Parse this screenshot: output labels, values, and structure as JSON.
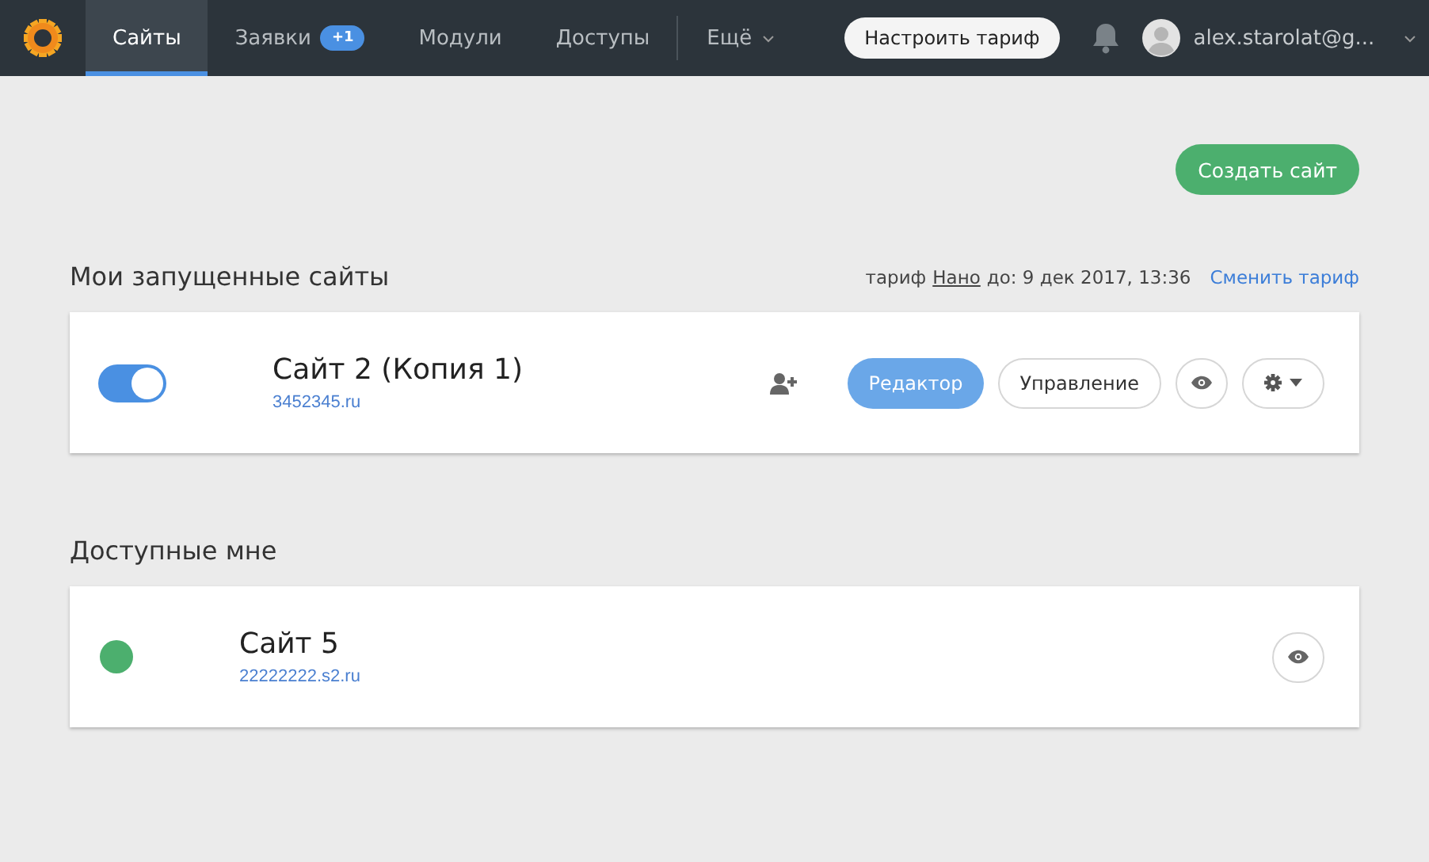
{
  "nav": {
    "tabs": [
      {
        "label": "Сайты",
        "selected": true
      },
      {
        "label": "Заявки",
        "selected": false,
        "badge": "+1"
      },
      {
        "label": "Модули",
        "selected": false
      },
      {
        "label": "Доступы",
        "selected": false
      }
    ],
    "more": "Ещё",
    "tariff_button": "Настроить тариф",
    "user": "alex.starolat@g..."
  },
  "create_button": "Создать сайт",
  "sections": [
    {
      "title": "Мои запущенные сайты",
      "tariff": {
        "label": "тариф",
        "plan": "Нано",
        "until": "до: 9 дек 2017, 13:36",
        "link": "Сменить тариф"
      },
      "sites": [
        {
          "kind": "toggle",
          "on": true,
          "name": "Сайт 2 (Копия 1)",
          "domain": "3452345.ru",
          "actions": [
            {
              "kind": "add-user"
            },
            {
              "kind": "primary",
              "label": "Редактор"
            },
            {
              "kind": "secondary",
              "label": "Управление"
            },
            {
              "kind": "eye"
            },
            {
              "kind": "gear"
            }
          ]
        }
      ]
    },
    {
      "title": "Доступные мне",
      "sites": [
        {
          "kind": "dot",
          "color": "#4caf6e",
          "name": "Сайт 5",
          "domain": "22222222.s2.ru",
          "actions": [
            {
              "kind": "eye"
            }
          ]
        }
      ]
    }
  ]
}
